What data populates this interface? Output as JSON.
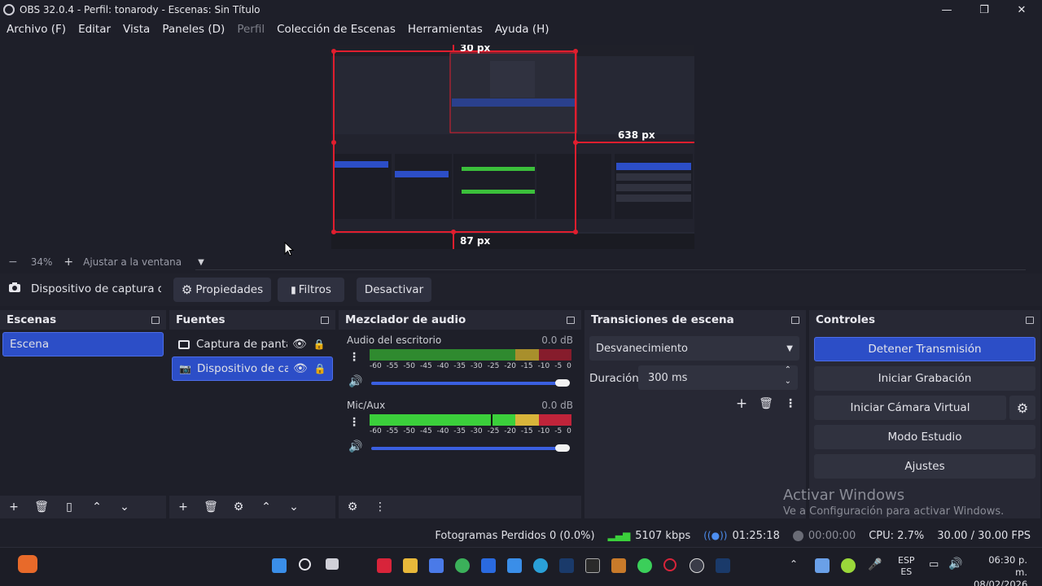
{
  "window": {
    "title": "OBS 32.0.4 - Perfil: tonarody - Escenas: Sin Título",
    "minimize": "—",
    "maximize": "❐",
    "close": "✕"
  },
  "menu": {
    "items": [
      "Archivo (F)",
      "Editar",
      "Vista",
      "Paneles (D)",
      "Perfil",
      "Colección de Escenas",
      "Herramientas",
      "Ayuda (H)"
    ]
  },
  "preview": {
    "overlay_top": "30 px",
    "overlay_right": "638 px",
    "overlay_bottom": "87 px"
  },
  "zoom": {
    "minus": "−",
    "value": "34%",
    "plus": "+",
    "fit_label": "Ajustar a la ventana"
  },
  "source_toolbar": {
    "selected_source": "Dispositivo de captura de v",
    "properties": "Propiedades",
    "filters": "Filtros",
    "deactivate": "Desactivar"
  },
  "scenes": {
    "title": "Escenas",
    "items": [
      "Escena"
    ]
  },
  "sources": {
    "title": "Fuentes",
    "items": [
      "Captura de pantall",
      "Dispositivo de cap"
    ]
  },
  "mixer": {
    "title": "Mezclador de audio",
    "channels": [
      {
        "name": "Audio del escritorio",
        "db": "0.0 dB"
      },
      {
        "name": "Mic/Aux",
        "db": "0.0 dB"
      }
    ],
    "ticks": [
      "-60",
      "-55",
      "-50",
      "-45",
      "-40",
      "-35",
      "-30",
      "-25",
      "-20",
      "-15",
      "-10",
      "-5",
      "0"
    ]
  },
  "transitions": {
    "title": "Transiciones de escena",
    "selected": "Desvanecimiento",
    "duration_label": "Duración",
    "duration_value": "300 ms"
  },
  "controls": {
    "title": "Controles",
    "stop_stream": "Detener Transmisión",
    "start_recording": "Iniciar Grabación",
    "start_virtualcam": "Iniciar Cámara Virtual",
    "studio_mode": "Modo Estudio",
    "settings": "Ajustes"
  },
  "watermark": {
    "line1": "Activar Windows",
    "line2": "Ve a Configuración para activar Windows."
  },
  "status": {
    "dropped_frames": "Fotogramas Perdidos 0 (0.0%)",
    "bitrate": "5107 kbps",
    "stream_time": "01:25:18",
    "rec_time": "00:00:00",
    "cpu": "CPU: 2.7%",
    "fps": "30.00 / 30.00 FPS"
  },
  "taskbar": {
    "lang1": "ESP",
    "lang2": "ES",
    "time": "06:30 p. m.",
    "date": "08/02/2026"
  },
  "colors": {
    "accent": "#2c4ec7",
    "meter_green": "#3bbf3b",
    "meter_yellow": "#d4b83a",
    "meter_red": "#c0243a"
  }
}
